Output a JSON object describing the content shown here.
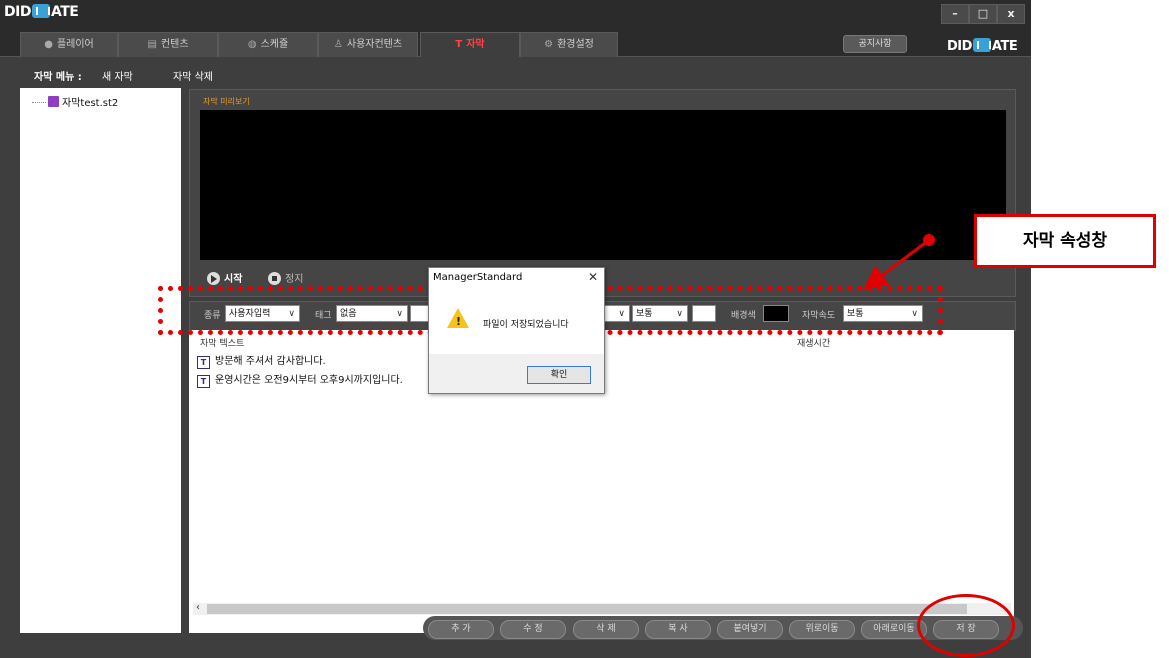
{
  "app": {
    "logo_text_left": "DID",
    "logo_text_right": "ATE",
    "window_buttons": {
      "minimize": "–",
      "maximize": "□",
      "close": "x"
    }
  },
  "tabs": [
    {
      "label": "플레이어",
      "icon": "play-icon"
    },
    {
      "label": "컨텐츠",
      "icon": "content-icon"
    },
    {
      "label": "스케쥴",
      "icon": "schedule-icon"
    },
    {
      "label": "사용자컨텐츠",
      "icon": "user-content-icon"
    },
    {
      "label": "자막",
      "icon": "caption-icon",
      "active": true
    },
    {
      "label": "환경설정",
      "icon": "settings-icon"
    }
  ],
  "header": {
    "notice_button": "공지사항"
  },
  "submenu": {
    "label": "자막 메뉴 :",
    "new_caption": "새 자막",
    "delete_caption": "자막 삭제"
  },
  "tree": {
    "items": [
      {
        "label": "자막test.st2"
      }
    ]
  },
  "preview": {
    "title": "자막 미리보기",
    "start": "시작",
    "stop": "정지"
  },
  "properties": {
    "type_label": "종류",
    "type_value": "사용자입력",
    "tag_label": "태그",
    "tag_value": "없음",
    "size_value": "보통",
    "bgcolor_label": "배경색",
    "speed_label": "자막속도",
    "speed_value": "보통"
  },
  "list": {
    "header_caption": "자막 텍스트",
    "header_time": "재생시간",
    "rows": [
      {
        "text": "방문해 주셔서 감사합니다."
      },
      {
        "text": "운영시간은 오전9시부터 오후9시까지입니다."
      }
    ]
  },
  "buttons": {
    "add": "추 가",
    "edit": "수 정",
    "delete": "삭 제",
    "copy": "복 사",
    "paste": "붙여넣기",
    "move_up": "위로이동",
    "move_down": "아래로이동",
    "save": "저 장"
  },
  "dialog": {
    "title": "ManagerStandard",
    "close": "✕",
    "message": "파일이 저장되었습니다",
    "ok": "확인"
  },
  "annotation": {
    "callout": "자막 속성창"
  },
  "colors": {
    "accent": "#ff4444",
    "annotation_red": "#e00000",
    "panel_title": "#e89c2a",
    "warning": "#f6c21b"
  }
}
